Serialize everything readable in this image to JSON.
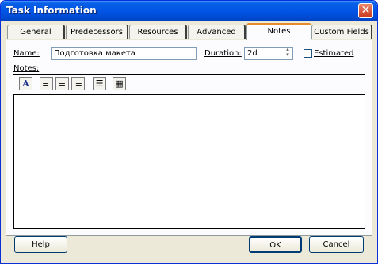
{
  "window": {
    "title": "Task Information",
    "close_glyph": "✕"
  },
  "tabs": [
    {
      "label": "General"
    },
    {
      "label": "Predecessors"
    },
    {
      "label": "Resources"
    },
    {
      "label": "Advanced"
    },
    {
      "label": "Notes"
    },
    {
      "label": "Custom Fields"
    }
  ],
  "active_tab": "Notes",
  "form": {
    "name_label": "Name:",
    "name_value": "Подготовка макета",
    "duration_label": "Duration:",
    "duration_value": "2d",
    "estimated_label": "Estimated",
    "estimated_checked": false,
    "notes_label": "Notes:"
  },
  "toolbar": [
    {
      "icon": "font-icon",
      "glyph": "A"
    },
    {
      "icon": "align-left-icon",
      "glyph": "≡"
    },
    {
      "icon": "align-center-icon",
      "glyph": "≡"
    },
    {
      "icon": "align-right-icon",
      "glyph": "≡"
    },
    {
      "icon": "bulleted-list-icon",
      "glyph": "☰"
    },
    {
      "icon": "insert-object-icon",
      "glyph": "▦"
    }
  ],
  "buttons": {
    "help": "Help",
    "ok": "OK",
    "cancel": "Cancel"
  }
}
